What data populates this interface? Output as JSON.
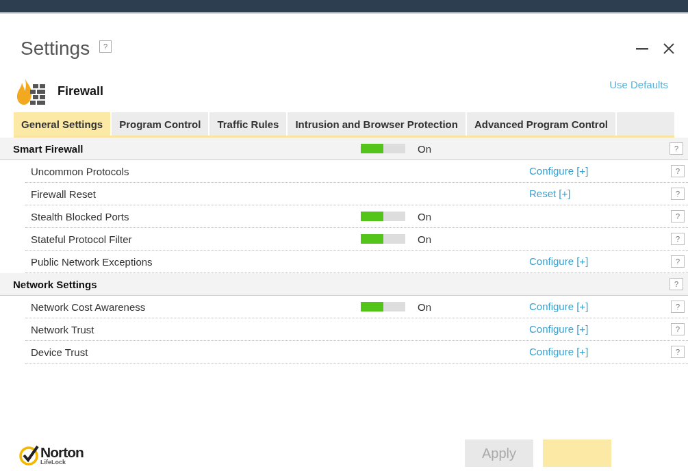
{
  "title": "Settings",
  "title_help": "?",
  "header": {
    "name": "Firewall",
    "use_defaults": "Use Defaults"
  },
  "tabs": [
    {
      "label": "General Settings",
      "selected": true
    },
    {
      "label": "Program Control",
      "selected": false
    },
    {
      "label": "Traffic Rules",
      "selected": false
    },
    {
      "label": "Intrusion and Browser Protection",
      "selected": false
    },
    {
      "label": "Advanced Program Control",
      "selected": false
    }
  ],
  "groups": [
    {
      "name": "Smart Firewall",
      "toggle": {
        "on": true,
        "label": "On"
      },
      "help": "?",
      "items": [
        {
          "name": "Uncommon Protocols",
          "action": "Configure [+]",
          "help": "?"
        },
        {
          "name": "Firewall Reset",
          "action": "Reset [+]",
          "help": "?"
        },
        {
          "name": "Stealth Blocked Ports",
          "toggle": {
            "on": true,
            "label": "On"
          },
          "help": "?"
        },
        {
          "name": "Stateful Protocol Filter",
          "toggle": {
            "on": true,
            "label": "On"
          },
          "help": "?"
        },
        {
          "name": "Public Network Exceptions",
          "action": "Configure [+]",
          "help": "?"
        }
      ]
    },
    {
      "name": "Network Settings",
      "help": "?",
      "items": [
        {
          "name": "Network Cost Awareness",
          "toggle": {
            "on": true,
            "label": "On"
          },
          "action": "Configure [+]",
          "help": "?"
        },
        {
          "name": "Network Trust",
          "action": "Configure [+]",
          "help": "?"
        },
        {
          "name": "Device Trust",
          "action": "Configure [+]",
          "help": "?"
        }
      ]
    }
  ],
  "buttons": [
    {
      "label": "Apply",
      "disabled": true
    },
    {
      "disabled": false
    }
  ],
  "footer": {
    "brand": "Norton",
    "sub": "LifeLock"
  }
}
